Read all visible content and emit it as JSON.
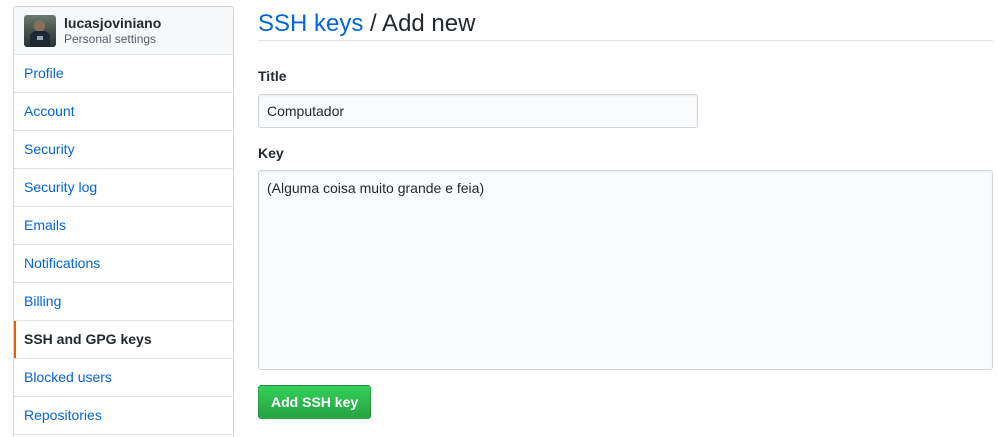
{
  "sidebar": {
    "username": "lucasjoviniano",
    "subtitle": "Personal settings",
    "items": [
      {
        "label": "Profile"
      },
      {
        "label": "Account"
      },
      {
        "label": "Security"
      },
      {
        "label": "Security log"
      },
      {
        "label": "Emails"
      },
      {
        "label": "Notifications"
      },
      {
        "label": "Billing"
      },
      {
        "label": "SSH and GPG keys",
        "selected": true
      },
      {
        "label": "Blocked users"
      },
      {
        "label": "Repositories"
      }
    ]
  },
  "header": {
    "link": "SSH keys",
    "rest": " / Add new"
  },
  "form": {
    "title_label": "Title",
    "title_value": "Computador",
    "key_label": "Key",
    "key_value": "(Alguma coisa muito grande e feia)",
    "submit_label": "Add SSH key"
  },
  "colors": {
    "link": "#0366d6",
    "selected_marker": "#e36209",
    "button": "#28a745"
  }
}
